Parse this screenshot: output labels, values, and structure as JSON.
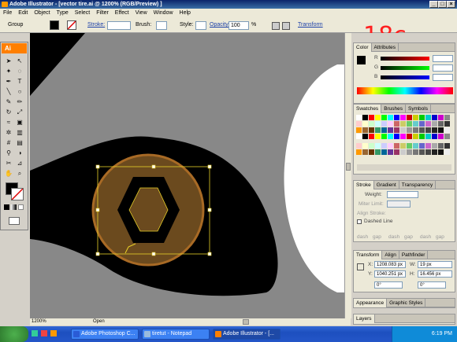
{
  "window": {
    "title": "Adobe Illustrator - [vector tire.ai @ 1200% (RGB/Preview) ]",
    "min": "_",
    "max": "□",
    "close": "×"
  },
  "menu": [
    "File",
    "Edit",
    "Object",
    "Type",
    "Select",
    "Filter",
    "Effect",
    "View",
    "Window",
    "Help"
  ],
  "control": {
    "group": "Group",
    "stroke_label": "Stroke:",
    "brush_label": "Brush:",
    "style_label": "Style:",
    "opacity_label": "Opacity:",
    "opacity_value": "100",
    "opacity_unit": "%",
    "transform_label": "Transform"
  },
  "tools": {
    "ai_label": "Ai"
  },
  "overlay_label": "18c",
  "status": {
    "zoom": "1200%",
    "state": "Open"
  },
  "color_panel": {
    "tabs": [
      "Color",
      "Attributes"
    ],
    "channels": [
      "R",
      "G",
      "B"
    ]
  },
  "swatches_panel": {
    "tabs": [
      "Swatches",
      "Brushes",
      "Symbols"
    ]
  },
  "stroke_panel": {
    "tabs": [
      "Stroke",
      "Gradient",
      "Transparency"
    ],
    "weight_label": "Weight:",
    "miter_label": "Miter Limit:",
    "align_label": "Align Stroke:",
    "dashed_label": "Dashed Line",
    "dash_labels": [
      "dash",
      "gap",
      "dash",
      "gap",
      "dash",
      "gap"
    ]
  },
  "transform_panel": {
    "tabs": [
      "Transform",
      "Align",
      "Pathfinder"
    ],
    "x_label": "X:",
    "x_value": "1208.083 px",
    "y_label": "Y:",
    "y_value": "1040.251 px",
    "w_label": "W:",
    "w_value": "19 px",
    "h_label": "H:",
    "h_value": "16.456 px",
    "rot_value": "0°",
    "shear_value": "0°"
  },
  "appearance_panel": {
    "tabs": [
      "Appearance",
      "Graphic Styles"
    ]
  },
  "layers_panel": {
    "tabs": [
      "Layers"
    ]
  },
  "taskbar": {
    "start": "start",
    "tasks": [
      "Adobe Photoshop C...",
      "tiretut - Notepad",
      "Adobe Illustrator - [..."
    ],
    "clock": "6:19 PM"
  },
  "colors": {
    "accent_orange": "#ff7f00",
    "tire_black": "#000000",
    "hub_brown": "#6b4a1e",
    "rim_orange": "#a86a25"
  }
}
